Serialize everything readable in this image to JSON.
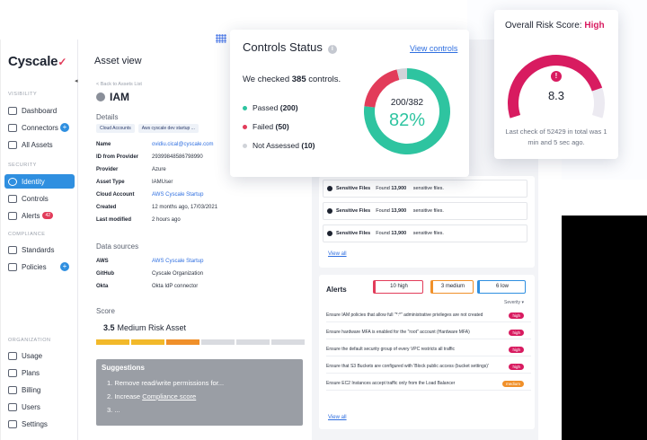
{
  "sidebar": {
    "logo": "Cyscale",
    "sections": [
      {
        "title": "VISIBILITY",
        "items": [
          {
            "label": "Dashboard"
          },
          {
            "label": "Connectors",
            "plus": true
          },
          {
            "label": "All Assets"
          }
        ]
      },
      {
        "title": "SECURITY",
        "items": [
          {
            "label": "Identity",
            "active": true
          },
          {
            "label": "Controls"
          },
          {
            "label": "Alerts",
            "badge": "42"
          }
        ]
      },
      {
        "title": "COMPLIANCE",
        "items": [
          {
            "label": "Standards"
          },
          {
            "label": "Policies",
            "plus": true
          }
        ]
      },
      {
        "title": "ORGANIZATION",
        "items": [
          {
            "label": "Usage"
          },
          {
            "label": "Plans"
          },
          {
            "label": "Billing"
          },
          {
            "label": "Users"
          },
          {
            "label": "Settings"
          }
        ]
      }
    ]
  },
  "main": {
    "page_title": "Asset view",
    "back_link": "< Back to Assets List",
    "asset_name": "IAM",
    "details_title": "Details",
    "chips": [
      "Cloud Accounts",
      "Aws cyscale dev startup ..."
    ],
    "details": [
      {
        "k": "Name",
        "v": "ovidiu.cical@cyscale.com",
        "link": true
      },
      {
        "k": "ID from Provider",
        "v": "29399848586798990"
      },
      {
        "k": "Provider",
        "v": "Azure"
      },
      {
        "k": "Asset Type",
        "v": "IAMUser"
      },
      {
        "k": "Cloud Account",
        "v": "AWS Cyscale Startup",
        "link": true
      },
      {
        "k": "Created",
        "v": "12 months ago, 17/03/2021"
      },
      {
        "k": "Last modified",
        "v": "2 hours ago"
      }
    ],
    "datasources_title": "Data sources",
    "datasources": [
      {
        "k": "AWS",
        "v": "AWS Cyscale Startup",
        "link": true
      },
      {
        "k": "GitHub",
        "v": "Cyscale Organization"
      },
      {
        "k": "Okta",
        "v": "Okta IdP connector"
      }
    ],
    "score_title": "Score",
    "score_value": "3.5",
    "score_label": "Medium Risk Asset",
    "score_segments": 6,
    "score_filled": 3,
    "suggestions_title": "Suggestions",
    "suggestions": [
      "1. Remove read/write permissions for...",
      "2. Increase",
      "3. ..."
    ],
    "suggestion_link": "Compliance score"
  },
  "files": {
    "rows": [
      {
        "label": "Sensitive Files",
        "text": "Found",
        "count": "13,900",
        "suffix": "sensitive files."
      },
      {
        "label": "Sensitive Files",
        "text": "Found",
        "count": "13,900",
        "suffix": "sensitive files."
      },
      {
        "label": "Sensitive Files",
        "text": "Found",
        "count": "13,900",
        "suffix": "sensitive files."
      }
    ],
    "view_all": "View all"
  },
  "alerts": {
    "title": "Alerts",
    "filters": [
      {
        "label": "10 high",
        "color": "#e23c5a"
      },
      {
        "label": "3 medium",
        "color": "#f0902a"
      },
      {
        "label": "6 low",
        "color": "#2f8fe0"
      }
    ],
    "severity_header": "Severity",
    "rows": [
      {
        "text": "Ensure IAM policies that allow full \"*:*\" administrative privileges are not created",
        "sev": "high"
      },
      {
        "text": "Ensure hardware MFA is enabled for the \"root\" account (Hardware MFA)",
        "sev": "high"
      },
      {
        "text": "Ensure the default security group of every VPC restricts all traffic",
        "sev": "high"
      },
      {
        "text": "Ensure that S3 Buckets are configured with 'Block public access (bucket settings)'",
        "sev": "high"
      },
      {
        "text": "Ensure EC2 Instances accept traffic only from the Load Balancer",
        "sev": "medium"
      }
    ],
    "view_all": "View all"
  },
  "controls_card": {
    "title": "Controls Status",
    "view_link": "View controls",
    "checked_prefix": "We checked",
    "checked_count": "385",
    "checked_suffix": "controls.",
    "legend": [
      {
        "label": "Passed",
        "count": "(200)",
        "color": "#2ec4a0"
      },
      {
        "label": "Failed",
        "count": "(50)",
        "color": "#e23c5a"
      },
      {
        "label": "Not Assessed",
        "count": "(10)",
        "color": "#d0d3d9"
      }
    ],
    "ratio": "200/382",
    "percent": "82%",
    "donut": {
      "passed": 200,
      "failed": 50,
      "not_assessed": 10
    }
  },
  "risk_card": {
    "title": "Overall Risk Score:",
    "level": "High",
    "score": "8.3",
    "gauge_fraction": 0.83,
    "footer": "Last check of 52429 in total was 1 min and 5 sec ago."
  }
}
